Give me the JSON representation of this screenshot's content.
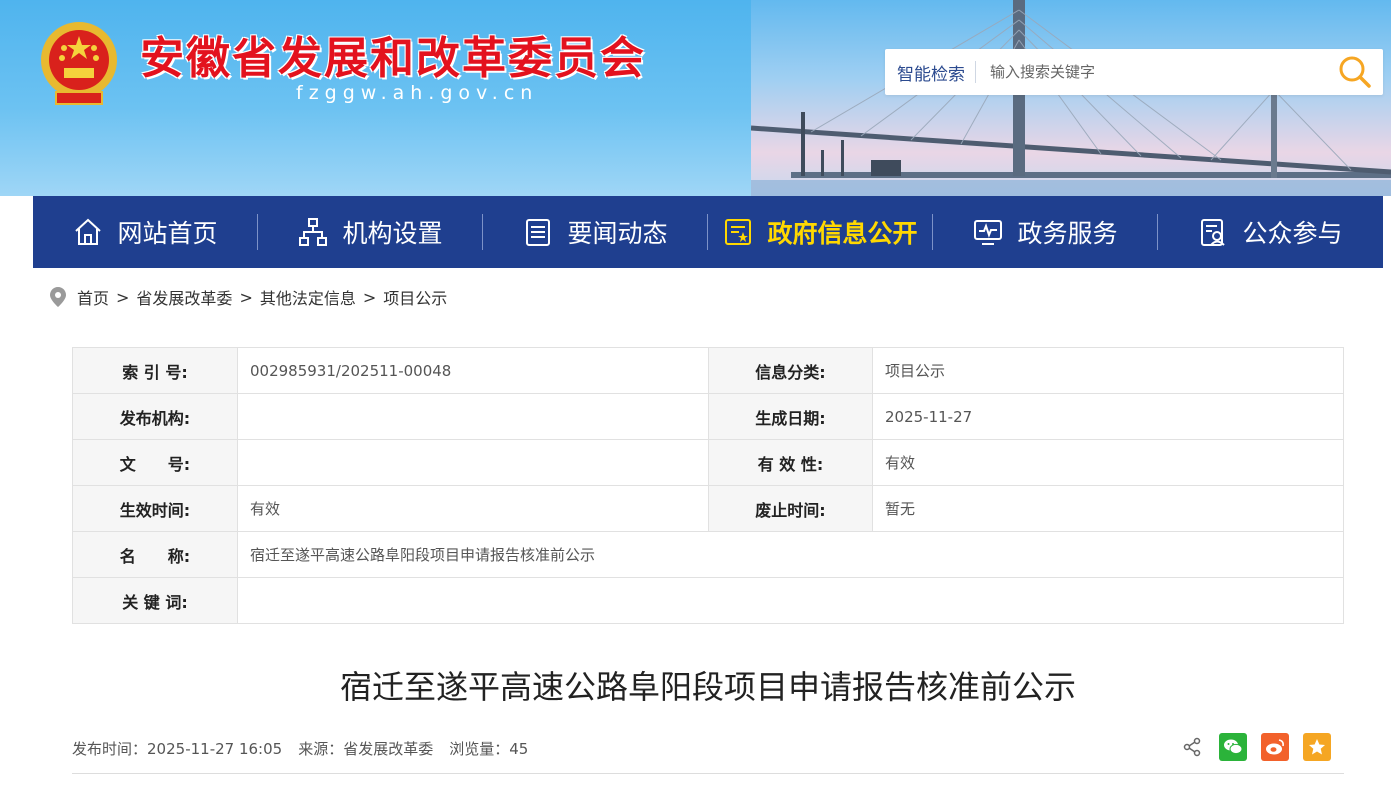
{
  "header": {
    "site_title": "安徽省发展和改革委员会",
    "site_domain": "fzggw.ah.gov.cn",
    "emblem_icon": "national-emblem-icon",
    "title_color": "#e3121e"
  },
  "search": {
    "label": "智能检索",
    "placeholder": "输入搜索关键字",
    "button_icon": "search-icon"
  },
  "nav": {
    "background": "#1f3f8f",
    "active_color": "#ffd800",
    "items": [
      {
        "label": "网站首页",
        "icon": "home-icon"
      },
      {
        "label": "机构设置",
        "icon": "org-chart-icon"
      },
      {
        "label": "要闻动态",
        "icon": "news-icon"
      },
      {
        "label": "政府信息公开",
        "icon": "info-disclosure-icon",
        "active": true
      },
      {
        "label": "政务服务",
        "icon": "monitor-icon"
      },
      {
        "label": "公众参与",
        "icon": "participation-icon"
      }
    ]
  },
  "breadcrumb": {
    "icon": "location-pin-icon",
    "items": [
      "首页",
      "省发展改革委",
      "其他法定信息",
      "项目公示"
    ],
    "separator": ">"
  },
  "meta_table": {
    "rows": [
      {
        "k1": "索 引 号:",
        "v1": "002985931/202511-00048",
        "k2": "信息分类:",
        "v2": "项目公示"
      },
      {
        "k1": "发布机构:",
        "v1": "",
        "k2": "生成日期:",
        "v2": "2025-11-27"
      },
      {
        "k1": "文　　号:",
        "v1": "",
        "k2": "有 效 性:",
        "v2": "有效"
      },
      {
        "k1": "生效时间:",
        "v1": "有效",
        "k2": "废止时间:",
        "v2": "暂无"
      }
    ],
    "name_label": "名　　称:",
    "name_value": "宿迁至遂平高速公路阜阳段项目申请报告核准前公示",
    "keywords_label": "关 键 词:",
    "keywords_value": ""
  },
  "article": {
    "title": "宿迁至遂平高速公路阜阳段项目申请报告核准前公示",
    "publish_time_label": "发布时间：",
    "publish_time": "2025-11-27 16:05",
    "source_label": "来源：",
    "source": "省发展改革委",
    "views_label": "浏览量：",
    "views": "45"
  },
  "share": {
    "icons": [
      "share-icon",
      "wechat-icon",
      "weibo-icon",
      "favorite-icon"
    ],
    "wechat_color": "#2bb33a",
    "weibo_color": "#f2612b",
    "favorite_color": "#f5a623"
  }
}
